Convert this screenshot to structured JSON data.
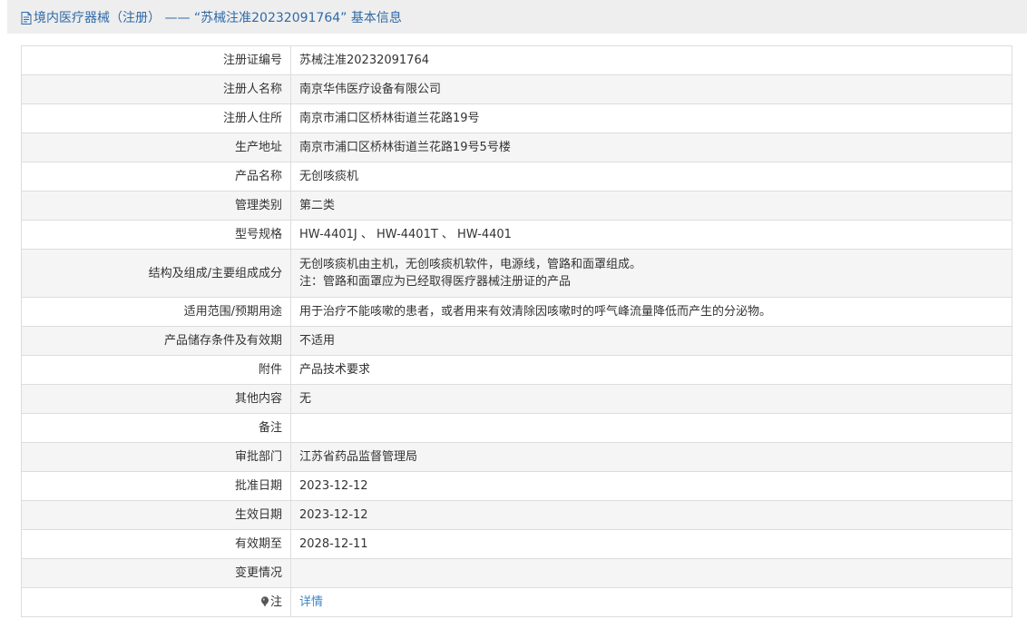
{
  "header": {
    "title": "境内医疗器械（注册） ——  “苏械注准20232091764” 基本信息"
  },
  "rows": [
    {
      "label": "注册证编号",
      "value": "苏械注准20232091764"
    },
    {
      "label": "注册人名称",
      "value": "南京华伟医疗设备有限公司"
    },
    {
      "label": "注册人住所",
      "value": "南京市浦口区桥林街道兰花路19号"
    },
    {
      "label": "生产地址",
      "value": "南京市浦口区桥林街道兰花路19号5号楼"
    },
    {
      "label": "产品名称",
      "value": "无创咳痰机"
    },
    {
      "label": "管理类别",
      "value": "第二类"
    },
    {
      "label": "型号规格",
      "value": "HW-4401J 、 HW-4401T 、 HW-4401"
    },
    {
      "label": "结构及组成/主要组成成分",
      "value_line1": "无创咳痰机由主机，无创咳痰机软件，电源线，管路和面罩组成。",
      "value_line2": "注：管路和面罩应为已经取得医疗器械注册证的产品"
    },
    {
      "label": "适用范围/预期用途",
      "value": "用于治疗不能咳嗽的患者，或者用来有效清除因咳嗽时的呼气峰流量降低而产生的分泌物。"
    },
    {
      "label": "产品储存条件及有效期",
      "value": "不适用"
    },
    {
      "label": "附件",
      "value": "产品技术要求"
    },
    {
      "label": "其他内容",
      "value": "无"
    },
    {
      "label": "备注",
      "value": ""
    },
    {
      "label": "审批部门",
      "value": "江苏省药品监督管理局"
    },
    {
      "label": "批准日期",
      "value": "2023-12-12"
    },
    {
      "label": "生效日期",
      "value": "2023-12-12"
    },
    {
      "label": "有效期至",
      "value": "2028-12-11"
    },
    {
      "label": "变更情况",
      "value": ""
    },
    {
      "label": "注",
      "value": "详情",
      "icon": "pin-icon"
    }
  ],
  "colors": {
    "title_text": "#2f6aa8",
    "title_bar_bg": "#eeeeee",
    "link": "#3a87c8",
    "row_alt_bg": "#f5f5f5",
    "border": "#dddddd"
  },
  "icons": {
    "title": "document-icon",
    "note": "pin-icon"
  }
}
